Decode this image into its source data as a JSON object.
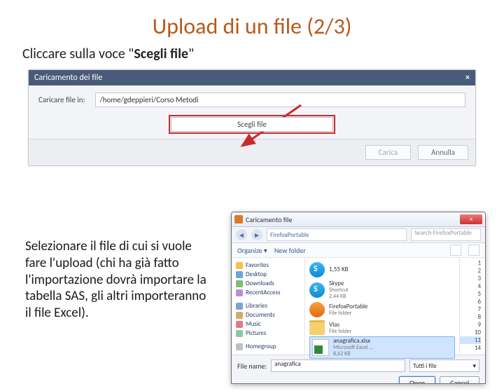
{
  "title": "Upload di un file (2/3)",
  "subtitle_prefix": "Cliccare sulla voce \"",
  "subtitle_bold": "Scegli file",
  "subtitle_suffix": "\"",
  "upload": {
    "titlebar": "Caricamento dei file",
    "close": "×",
    "path_label": "Caricare file in:",
    "path_value": "/home/gdeppieri/Corso Metodi",
    "choose_button": "Scegli file",
    "btn_load": "Carica",
    "btn_cancel": "Annulla"
  },
  "para2": "Selezionare il file di cui si vuole fare l'upload (chi ha già fatto l'importazione dovrà importare la tabella SAS, gli altri importeranno il file Excel).",
  "chooser": {
    "window_title": "Caricamento file",
    "breadcrumb": "FirefoxPortable",
    "search_placeholder": "Search FirefoxPortable",
    "organize": "Organize ▾",
    "newfolder": "New folder",
    "nav": {
      "favorites": "Favorites",
      "desktop": "Desktop",
      "downloads": "Downloads",
      "recent": "RecentAccess",
      "libraries": "Libraries",
      "documents": "Documents",
      "music": "Music",
      "pictures": "Pictures",
      "homegroup": "Homegroup"
    },
    "files": {
      "f1_name": "Skype",
      "f1_sub1": "Shortcut",
      "f1_sub2": "1,55 KB",
      "f2_name": "Skype",
      "f2_sub1": "Shortcut",
      "f2_sub2": "2,44 KB",
      "f3_name": "FirefoxPortable",
      "f3_sub1": "File folder",
      "f4_name": "Vlas",
      "f4_sub1": "File folder",
      "f5_name": "anagrafica.xlsx",
      "f5_sub1": "Microsoft Excel ...",
      "f5_sub2": "8,62 KB"
    },
    "nums": [
      "1",
      "2",
      "3",
      "4",
      "5",
      "6",
      "7",
      "8",
      "9",
      "10",
      "11",
      "14"
    ],
    "file_label": "File name:",
    "file_value": "anagrafica",
    "type_value": "Tutti i file",
    "open": "Open",
    "cancel": "Cancel"
  }
}
